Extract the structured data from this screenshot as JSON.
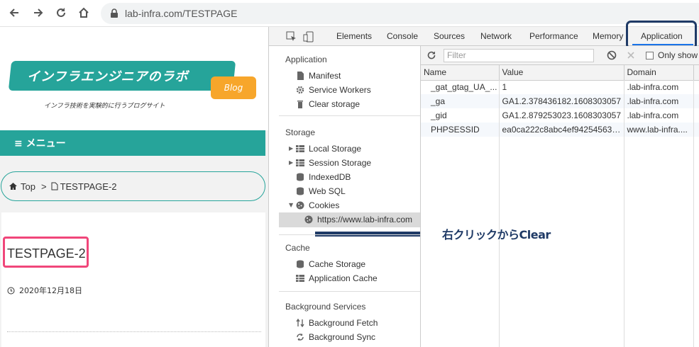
{
  "browser": {
    "url": "lab-infra.com/TESTPAGE"
  },
  "webpage": {
    "logo_text": "インフラエンジニアのラボ",
    "logo_blog": "Blog",
    "logo_sub": "インフラ技術を実験的に行うブログサイト",
    "menu_label": "≡ メニュー",
    "breadcrumb": {
      "home": "Top",
      "separator": ">",
      "current": "TESTPAGE-2"
    },
    "title": "TESTPAGE-2",
    "date": "2020年12月18日"
  },
  "devtools": {
    "tabs": [
      "Elements",
      "Console",
      "Sources",
      "Network",
      "Performance",
      "Memory",
      "Application"
    ],
    "active_tab": "Application",
    "sidebar": {
      "application_header": "Application",
      "application_items": [
        "Manifest",
        "Service Workers",
        "Clear storage"
      ],
      "storage_header": "Storage",
      "storage_items": [
        "Local Storage",
        "Session Storage",
        "IndexedDB",
        "Web SQL",
        "Cookies"
      ],
      "cookie_origin": "https://www.lab-infra.com",
      "cache_header": "Cache",
      "cache_items": [
        "Cache Storage",
        "Application Cache"
      ],
      "bg_header": "Background Services",
      "bg_items": [
        "Background Fetch",
        "Background Sync"
      ]
    },
    "filter_placeholder": "Filter",
    "only_show_label": "Only show",
    "table": {
      "columns": [
        "Name",
        "Value",
        "Domain"
      ],
      "rows": [
        {
          "name": "_gat_gtag_UA_...",
          "value": "1",
          "domain": ".lab-infra.com"
        },
        {
          "name": "_ga",
          "value": "GA1.2.378436182.1608303057",
          "domain": ".lab-infra.com"
        },
        {
          "name": "_gid",
          "value": "GA1.2.879253023.1608303057",
          "domain": ".lab-infra.com"
        },
        {
          "name": "PHPSESSID",
          "value": "ea0ca222c8abc4ef94254563e...",
          "domain": "www.lab-infra...."
        }
      ]
    }
  },
  "annotation": {
    "text": "右クリックからClear",
    "color": "#1f3a66"
  },
  "colors": {
    "teal": "#26a49a",
    "orange": "#f7a62b",
    "pink_highlight": "#f0467a",
    "navy_highlight": "#1f3a66"
  }
}
